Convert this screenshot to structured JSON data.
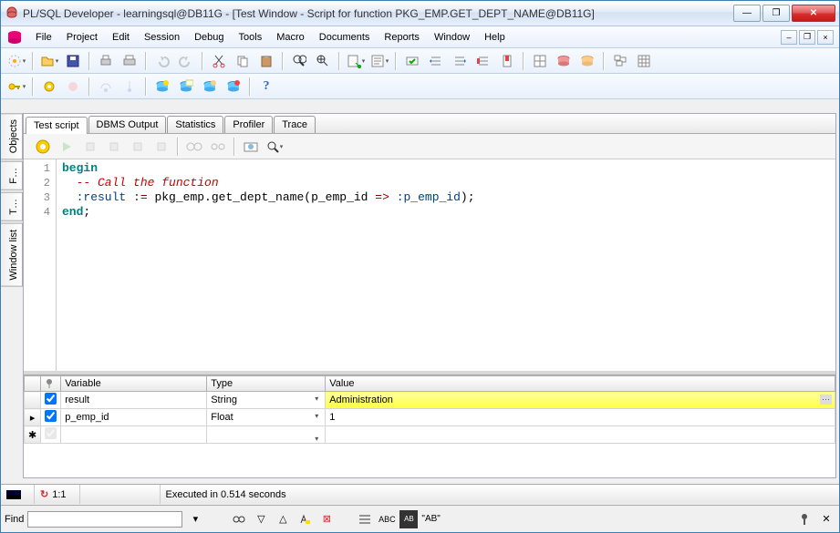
{
  "window": {
    "title": "PL/SQL Developer - learningsql@DB11G - [Test Window - Script for function PKG_EMP.GET_DEPT_NAME@DB11G]"
  },
  "menu": {
    "file": "File",
    "project": "Project",
    "edit": "Edit",
    "session": "Session",
    "debug": "Debug",
    "tools": "Tools",
    "macro": "Macro",
    "documents": "Documents",
    "reports": "Reports",
    "window": "Window",
    "help": "Help"
  },
  "sidebar": {
    "objects": "Objects",
    "files": "F…",
    "t": "T…",
    "windowlist": "Window list"
  },
  "tabs": {
    "testscript": "Test script",
    "dbmsoutput": "DBMS Output",
    "statistics": "Statistics",
    "profiler": "Profiler",
    "trace": "Trace"
  },
  "editor": {
    "lines": [
      "1",
      "2",
      "3",
      "4"
    ],
    "l1_begin": "begin",
    "l2_comment": "  -- Call the function",
    "l3_a": "  :result",
    "l3_assign": " := ",
    "l3_b": "pkg_emp.get_dept_name(p_emp_id",
    "l3_arrow": " => ",
    "l3_c": ":p_emp_id",
    "l3_end": ");",
    "l4_end": "end",
    "l4_semi": ";"
  },
  "vars": {
    "hdr_pin": "",
    "hdr_var": "Variable",
    "hdr_type": "Type",
    "hdr_val": "Value",
    "rows": [
      {
        "checked": true,
        "name": "result",
        "type": "String",
        "value": "Administration",
        "selected": true
      },
      {
        "checked": true,
        "name": "p_emp_id",
        "type": "Float",
        "value": "1",
        "selected": false
      }
    ],
    "row_marker": "▸",
    "new_marker": "✱"
  },
  "status": {
    "pos": "1:1",
    "exec": "Executed in 0.514 seconds"
  },
  "find": {
    "label": "Find",
    "ab": "\"AB\""
  }
}
